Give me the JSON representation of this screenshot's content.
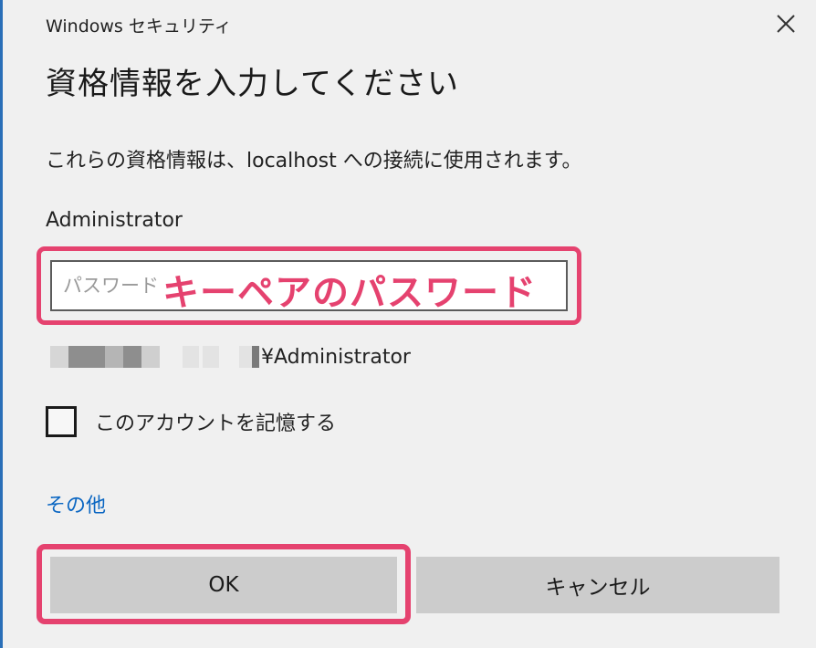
{
  "window": {
    "title": "Windows セキュリティ",
    "close_icon": "close-icon"
  },
  "dialog": {
    "heading": "資格情報を入力してください",
    "description": "これらの資格情報は、localhost への接続に使用されます。",
    "username_label": "Administrator",
    "password_placeholder": "パスワード",
    "password_annotation": "キーペアのパスワード",
    "account_text": "¥Administrator",
    "remember_label": "このアカウントを記憶する",
    "remember_checked": false,
    "more_link": "その他",
    "ok_label": "OK",
    "cancel_label": "キャンセル"
  },
  "colors": {
    "annotation": "#e5426f",
    "link": "#0a66c2",
    "button_bg": "#cccccc",
    "window_accent": "#2a6fb8"
  }
}
